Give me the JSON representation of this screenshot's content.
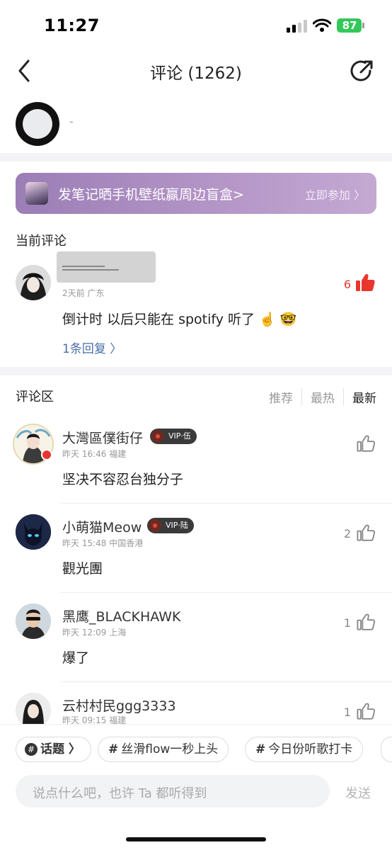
{
  "status": {
    "time": "11:27",
    "battery": "87"
  },
  "nav": {
    "title": "评论 (1262)"
  },
  "song": {
    "subtitle": "-"
  },
  "banner": {
    "text": "发笔记晒手机壁纸赢周边盲盒>",
    "cta": "立即参加 〉"
  },
  "current": {
    "label": "当前评论",
    "meta": "2天前 广东",
    "text": "倒计时 以后只能在 spotify 听了 ☝️ 🤓",
    "likes": "6",
    "replies": "1条回复 〉"
  },
  "comments_section": {
    "label": "评论区",
    "tabs": [
      "推荐",
      "最热",
      "最新"
    ]
  },
  "comments": [
    {
      "name": "大灣區僕街仔",
      "vip": "VIP·伍",
      "meta": "昨天 16:46 福建",
      "text": "坚决不容忍台独分子",
      "likes": ""
    },
    {
      "name": "小萌猫Meow",
      "vip": "VIP·陆",
      "meta": "昨天 15:48 中国香港",
      "text": "觀光團",
      "likes": "2"
    },
    {
      "name": "黑鹰_BLACKHAWK",
      "vip": "",
      "meta": "昨天 12:09 上海",
      "text": "爆了",
      "likes": "1"
    },
    {
      "name": "云村村民ggg3333",
      "vip": "",
      "meta": "昨天 09:15 福建",
      "text": "",
      "likes": "1"
    }
  ],
  "chips": [
    {
      "label": "话题 〉"
    },
    {
      "label": "丝滑flow一秒上头"
    },
    {
      "label": "今日份听歌打卡"
    }
  ],
  "composer": {
    "placeholder": "说点什么吧，也许 Ta 都听得到",
    "send": "发送"
  },
  "colors": {
    "like_active": "#e8362f",
    "banner": "#a98bbf"
  },
  "icons": [
    "back-icon",
    "share-icon",
    "thumb-up-icon",
    "signal-icon",
    "wifi-icon",
    "battery-icon"
  ]
}
